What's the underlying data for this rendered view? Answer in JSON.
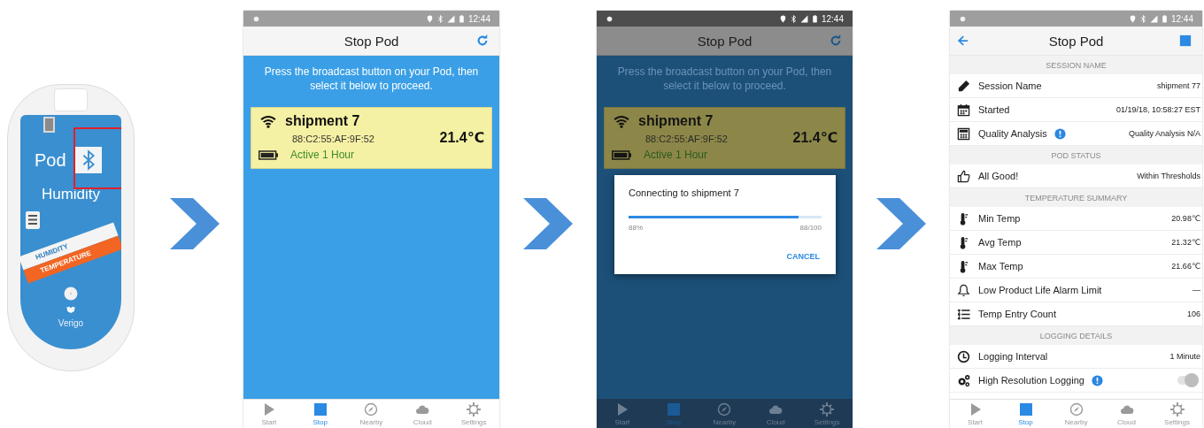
{
  "device": {
    "name_label": "Pod",
    "sensor_label": "Humidity",
    "button_highlighted": true,
    "stripes": [
      {
        "label": "HUMIDITY",
        "color": "#f4f4f4"
      },
      {
        "label": "TEMPERATURE",
        "color": "#f26522"
      }
    ],
    "maker": "Verigo"
  },
  "screens": [
    {
      "kind": "scan",
      "dimmed": false,
      "status_time": "12:44",
      "title": "Stop Pod",
      "instruction": "Press the broadcast button on your Pod, then select it below to proceed.",
      "pods": [
        {
          "name": "shipment 7",
          "address": "88:C2:55:AF:9F:52",
          "temperature": "21.4℃",
          "status": "Active 1 Hour"
        }
      ],
      "tabs": [
        {
          "label": "Start",
          "selected": false
        },
        {
          "label": "Stop",
          "selected": true
        },
        {
          "label": "Nearby",
          "selected": false
        },
        {
          "label": "Cloud",
          "selected": false
        },
        {
          "label": "Settings",
          "selected": false
        }
      ]
    },
    {
      "kind": "scan",
      "dimmed": true,
      "status_time": "12:44",
      "title": "Stop Pod",
      "instruction": "Press the broadcast button on your Pod, then select it below to proceed.",
      "pods": [
        {
          "name": "shipment 7",
          "address": "88:C2:55:AF:9F:52",
          "temperature": "21.4℃",
          "status": "Active 1 Hour"
        }
      ],
      "dialog": {
        "message": "Connecting to shipment 7",
        "level": 0.88,
        "percent": "88%",
        "count": "88/100",
        "button": "CANCEL"
      },
      "tabs": [
        {
          "label": "Start",
          "selected": false
        },
        {
          "label": "Stop",
          "selected": true
        },
        {
          "label": "Nearby",
          "selected": false
        },
        {
          "label": "Cloud",
          "selected": false
        },
        {
          "label": "Settings",
          "selected": false
        }
      ]
    },
    {
      "kind": "details",
      "dimmed": false,
      "status_time": "12:44",
      "title": "Stop Pod",
      "sections": [
        {
          "header": "SESSION NAME",
          "rows": [
            {
              "kind": "value",
              "label": "Session Name",
              "info": false,
              "value": "shipment 77"
            },
            {
              "kind": "value",
              "label": "Started",
              "info": false,
              "value": "01/19/18, 10:58:27 EST"
            },
            {
              "kind": "value",
              "label": "Quality Analysis",
              "info": true,
              "value": "Quality Analysis N/A"
            }
          ]
        },
        {
          "header": "POD STATUS",
          "rows": [
            {
              "kind": "value",
              "label": "All Good!",
              "info": false,
              "value": "Within Thresholds"
            }
          ]
        },
        {
          "header": "TEMPERATURE SUMMARY",
          "rows": [
            {
              "kind": "value",
              "label": "Min Temp",
              "info": false,
              "value": "20.98℃"
            },
            {
              "kind": "value",
              "label": "Avg Temp",
              "info": false,
              "value": "21.32℃"
            },
            {
              "kind": "value",
              "label": "Max Temp",
              "info": false,
              "value": "21.66℃"
            },
            {
              "kind": "value",
              "label": "Low Product Life Alarm Limit",
              "info": false,
              "value": "—"
            },
            {
              "kind": "value",
              "label": "Temp Entry Count",
              "info": false,
              "value": "106"
            }
          ]
        },
        {
          "header": "LOGGING DETAILS",
          "rows": [
            {
              "kind": "value",
              "label": "Logging Interval",
              "info": false,
              "value": "1 Minute"
            },
            {
              "kind": "toggle",
              "label": "High Resolution Logging",
              "info": true,
              "on": false
            }
          ]
        }
      ],
      "tabs": [
        {
          "label": "Start",
          "selected": false
        },
        {
          "label": "Stop",
          "selected": true
        },
        {
          "label": "Nearby",
          "selected": false
        },
        {
          "label": "Cloud",
          "selected": false
        },
        {
          "label": "Settings",
          "selected": false
        }
      ]
    }
  ]
}
